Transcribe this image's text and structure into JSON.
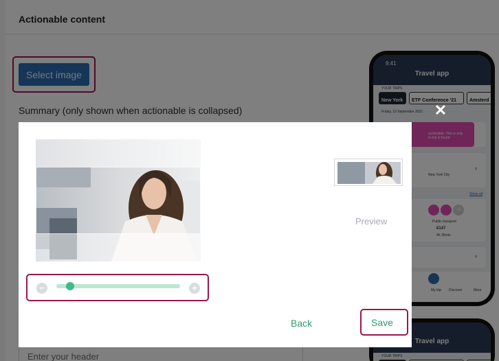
{
  "page": {
    "header_title": "Actionable content",
    "select_image_label": "Select image",
    "summary_label": "Summary (only shown when actionable is collapsed)",
    "header_placeholder": "Enter your header"
  },
  "phone": {
    "time": "9:41",
    "app_title": "Travel app",
    "trips_label": "YOUR TRIPS",
    "trips": [
      "New York",
      "ETF Conference '21",
      "Amsterd"
    ],
    "date_row": "Friday, 10 September 2021",
    "card_text": "actionable. This is only\nin-trip is found",
    "city": "New York City",
    "link_text": "Show all",
    "transport_label": "Public transport",
    "price": "€147",
    "duration": "4h 35min",
    "badge": "+3",
    "nav_labels": [
      "My trip",
      "Discover",
      "More"
    ],
    "second_title": "Travel app"
  },
  "modal": {
    "close_icon": "close-x-icon",
    "zoom_out_icon": "minus-circle-icon",
    "zoom_in_icon": "plus-circle-icon",
    "zoom_level": 0.1,
    "preview_label": "Preview",
    "back_label": "Back",
    "save_label": "Save"
  },
  "colors": {
    "accent_green": "#2e9b6c",
    "slider_track": "#bde6d2",
    "slider_knob": "#3dbb87",
    "highlight": "#9a1550",
    "primary_button": "#2b6cb0"
  }
}
